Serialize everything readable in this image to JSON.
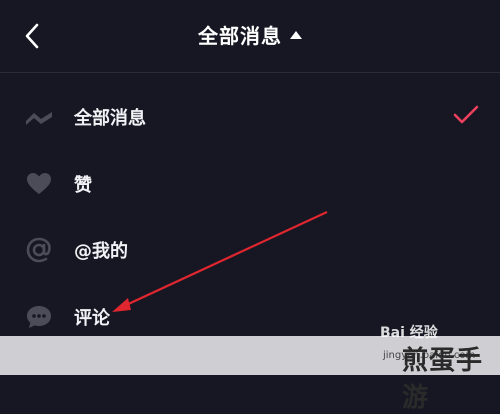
{
  "header": {
    "back_icon": "chevron-left-icon",
    "title": "全部消息",
    "title_caret_icon": "caret-up-icon"
  },
  "menu": {
    "items": [
      {
        "label": "全部消息",
        "icon": "wave-icon",
        "selected": true
      },
      {
        "label": "赞",
        "icon": "heart-icon",
        "selected": false
      },
      {
        "label": "@我的",
        "icon": "at-icon",
        "selected": false
      },
      {
        "label": "评论",
        "icon": "chat-bubble-icon",
        "selected": false
      }
    ],
    "check_icon": "checkmark-icon"
  },
  "colors": {
    "background": "#161722",
    "accent": "#f0405e",
    "icon": "#4b4c58",
    "annotation_arrow": "#e0262f"
  },
  "watermark": {
    "baidu": "Bai 经验",
    "baidu_sub": "jingyan.baidu.com",
    "game": "煎蛋手游"
  }
}
